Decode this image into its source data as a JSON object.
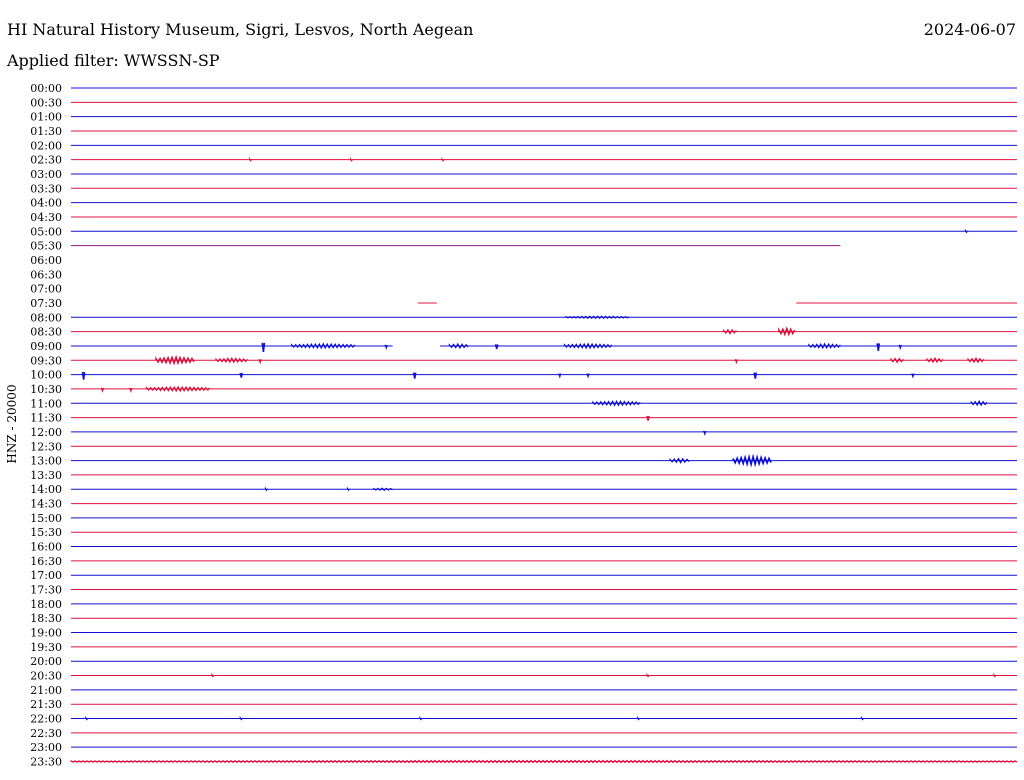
{
  "header": {
    "station": "HI Natural History Museum, Sigri, Lesvos, North Aegean",
    "date": "2024-06-07",
    "filter": "Applied filter: WWSSN-SP"
  },
  "colors": {
    "blue": "#1010d0",
    "red": "#e0103c",
    "purple": "#8a1e78",
    "text": "#000000",
    "background": "#ffffff"
  },
  "chart_data": {
    "type": "line",
    "ylabel": "HNZ - 20000",
    "grid": false,
    "legend": "none",
    "series_colors": "alternating blue / red by half-hour row",
    "xlim_minutes": [
      0,
      30
    ],
    "row_labels": [
      "00:00",
      "00:30",
      "01:00",
      "01:30",
      "02:00",
      "02:30",
      "03:00",
      "03:30",
      "04:00",
      "04:30",
      "05:00",
      "05:30",
      "06:00",
      "06:30",
      "07:00",
      "07:30",
      "08:00",
      "08:30",
      "09:00",
      "09:30",
      "10:00",
      "10:30",
      "11:00",
      "11:30",
      "12:00",
      "12:30",
      "13:00",
      "13:30",
      "14:00",
      "14:30",
      "15:00",
      "15:30",
      "16:00",
      "16:30",
      "17:00",
      "17:30",
      "18:00",
      "18:30",
      "19:00",
      "19:30",
      "20:00",
      "20:30",
      "21:00",
      "21:30",
      "22:00",
      "22:30",
      "23:00",
      "23:30"
    ],
    "traces": [
      {
        "row": "00:00",
        "start_min": 0,
        "end_min": 30
      },
      {
        "row": "00:30",
        "start_min": 0,
        "end_min": 30
      },
      {
        "row": "01:00",
        "start_min": 0,
        "end_min": 30
      },
      {
        "row": "01:30",
        "start_min": 0,
        "end_min": 30
      },
      {
        "row": "02:00",
        "start_min": 0,
        "end_min": 30
      },
      {
        "row": "02:30",
        "start_min": 0,
        "end_min": 30
      },
      {
        "row": "03:00",
        "start_min": 0,
        "end_min": 30
      },
      {
        "row": "03:30",
        "start_min": 0,
        "end_min": 30
      },
      {
        "row": "04:00",
        "start_min": 0,
        "end_min": 30
      },
      {
        "row": "04:30",
        "start_min": 0,
        "end_min": 30
      },
      {
        "row": "05:00",
        "start_min": 0,
        "end_min": 30
      },
      {
        "row": "05:30",
        "start_min": 0,
        "end_min": 24.4,
        "color": "purple"
      },
      {
        "row": "07:30",
        "start_min": 11.0,
        "end_min": 11.6
      },
      {
        "row": "07:30",
        "start_min": 23.0,
        "end_min": 30
      },
      {
        "row": "08:00",
        "start_min": 0,
        "end_min": 30
      },
      {
        "row": "08:30",
        "start_min": 0,
        "end_min": 30
      },
      {
        "row": "09:00",
        "start_min": 0,
        "end_min": 10.2
      },
      {
        "row": "09:00",
        "start_min": 11.7,
        "end_min": 30
      },
      {
        "row": "09:30",
        "start_min": 0,
        "end_min": 30
      },
      {
        "row": "10:00",
        "start_min": 0,
        "end_min": 30
      },
      {
        "row": "10:30",
        "start_min": 0,
        "end_min": 30
      },
      {
        "row": "11:00",
        "start_min": 0,
        "end_min": 30
      },
      {
        "row": "11:30",
        "start_min": 0,
        "end_min": 30
      },
      {
        "row": "12:00",
        "start_min": 0,
        "end_min": 30
      },
      {
        "row": "12:30",
        "start_min": 0,
        "end_min": 30
      },
      {
        "row": "13:00",
        "start_min": 0,
        "end_min": 30
      },
      {
        "row": "13:30",
        "start_min": 0,
        "end_min": 30
      },
      {
        "row": "14:00",
        "start_min": 0,
        "end_min": 30
      },
      {
        "row": "14:30",
        "start_min": 0,
        "end_min": 30
      },
      {
        "row": "15:00",
        "start_min": 0,
        "end_min": 30
      },
      {
        "row": "15:30",
        "start_min": 0,
        "end_min": 30
      },
      {
        "row": "16:00",
        "start_min": 0,
        "end_min": 30
      },
      {
        "row": "16:30",
        "start_min": 0,
        "end_min": 30
      },
      {
        "row": "17:00",
        "start_min": 0,
        "end_min": 30
      },
      {
        "row": "17:30",
        "start_min": 0,
        "end_min": 30
      },
      {
        "row": "18:00",
        "start_min": 0,
        "end_min": 30
      },
      {
        "row": "18:30",
        "start_min": 0,
        "end_min": 30
      },
      {
        "row": "19:00",
        "start_min": 0,
        "end_min": 30
      },
      {
        "row": "19:30",
        "start_min": 0,
        "end_min": 30
      },
      {
        "row": "20:00",
        "start_min": 0,
        "end_min": 30
      },
      {
        "row": "20:30",
        "start_min": 0,
        "end_min": 30
      },
      {
        "row": "21:00",
        "start_min": 0,
        "end_min": 30
      },
      {
        "row": "21:30",
        "start_min": 0,
        "end_min": 30
      },
      {
        "row": "22:00",
        "start_min": 0,
        "end_min": 30
      },
      {
        "row": "22:30",
        "start_min": 0,
        "end_min": 30
      },
      {
        "row": "23:00",
        "start_min": 0,
        "end_min": 30
      },
      {
        "row": "23:30",
        "start_min": 0,
        "end_min": 30
      }
    ],
    "events": [
      {
        "row": "02:30",
        "minute": 5.7,
        "amp": 1
      },
      {
        "row": "02:30",
        "minute": 8.9,
        "amp": 1
      },
      {
        "row": "02:30",
        "minute": 11.8,
        "amp": 1
      },
      {
        "row": "05:00",
        "minute": 28.4,
        "amp": 1
      },
      {
        "row": "08:00",
        "minute": 16.7,
        "amp": 1,
        "width": 2.0
      },
      {
        "row": "08:30",
        "minute": 20.9,
        "amp": 2,
        "width": 0.4
      },
      {
        "row": "08:30",
        "minute": 22.7,
        "amp": 3,
        "width": 0.5
      },
      {
        "row": "09:00",
        "minute": 6.1,
        "amp": 6
      },
      {
        "row": "09:00",
        "minute": 8.0,
        "amp": 2,
        "width": 2.0
      },
      {
        "row": "09:00",
        "minute": 10.0,
        "amp": 2
      },
      {
        "row": "09:00",
        "minute": 12.3,
        "amp": 2,
        "width": 0.6
      },
      {
        "row": "09:00",
        "minute": 13.5,
        "amp": 3
      },
      {
        "row": "09:00",
        "minute": 16.4,
        "amp": 2,
        "width": 1.5
      },
      {
        "row": "09:00",
        "minute": 23.9,
        "amp": 2,
        "width": 1.0
      },
      {
        "row": "09:00",
        "minute": 25.6,
        "amp": 5
      },
      {
        "row": "09:00",
        "minute": 26.3,
        "amp": 2
      },
      {
        "row": "09:30",
        "minute": 3.3,
        "amp": 3,
        "width": 1.2
      },
      {
        "row": "09:30",
        "minute": 5.1,
        "amp": 2,
        "width": 1.0
      },
      {
        "row": "09:30",
        "minute": 6.0,
        "amp": 2
      },
      {
        "row": "09:30",
        "minute": 21.1,
        "amp": 2
      },
      {
        "row": "09:30",
        "minute": 26.2,
        "amp": 2,
        "width": 0.4
      },
      {
        "row": "09:30",
        "minute": 27.4,
        "amp": 2,
        "width": 0.5
      },
      {
        "row": "09:30",
        "minute": 28.7,
        "amp": 2,
        "width": 0.5
      },
      {
        "row": "10:00",
        "minute": 0.4,
        "amp": 5
      },
      {
        "row": "10:00",
        "minute": 5.4,
        "amp": 3
      },
      {
        "row": "10:00",
        "minute": 10.9,
        "amp": 4
      },
      {
        "row": "10:00",
        "minute": 15.5,
        "amp": 2
      },
      {
        "row": "10:00",
        "minute": 16.4,
        "amp": 2
      },
      {
        "row": "10:00",
        "minute": 21.7,
        "amp": 4
      },
      {
        "row": "10:00",
        "minute": 26.7,
        "amp": 2
      },
      {
        "row": "10:30",
        "minute": 1.0,
        "amp": 2
      },
      {
        "row": "10:30",
        "minute": 1.9,
        "amp": 2
      },
      {
        "row": "10:30",
        "minute": 3.4,
        "amp": 2,
        "width": 2.0
      },
      {
        "row": "11:00",
        "minute": 17.3,
        "amp": 2,
        "width": 1.5
      },
      {
        "row": "11:00",
        "minute": 28.8,
        "amp": 2,
        "width": 0.5
      },
      {
        "row": "11:30",
        "minute": 18.3,
        "amp": 3
      },
      {
        "row": "12:00",
        "minute": 20.1,
        "amp": 2
      },
      {
        "row": "13:00",
        "minute": 19.3,
        "amp": 2,
        "width": 0.6
      },
      {
        "row": "13:00",
        "minute": 21.6,
        "amp": 4,
        "width": 1.2
      },
      {
        "row": "14:00",
        "minute": 6.2,
        "amp": 1
      },
      {
        "row": "14:00",
        "minute": 8.8,
        "amp": 1
      },
      {
        "row": "14:00",
        "minute": 9.9,
        "amp": 1,
        "width": 0.6
      },
      {
        "row": "20:30",
        "minute": 4.5,
        "amp": 1
      },
      {
        "row": "20:30",
        "minute": 18.3,
        "amp": 1
      },
      {
        "row": "20:30",
        "minute": 29.3,
        "amp": 1
      },
      {
        "row": "22:00",
        "minute": 0.5,
        "amp": 1
      },
      {
        "row": "22:00",
        "minute": 5.4,
        "amp": 1
      },
      {
        "row": "22:00",
        "minute": 11.1,
        "amp": 1
      },
      {
        "row": "22:00",
        "minute": 18.0,
        "amp": 1
      },
      {
        "row": "22:00",
        "minute": 25.1,
        "amp": 1
      },
      {
        "row": "23:30",
        "minute": 15.0,
        "amp": 1,
        "width": 30.0
      }
    ]
  }
}
